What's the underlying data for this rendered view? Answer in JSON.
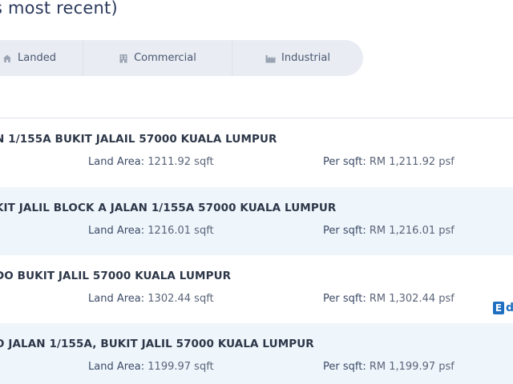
{
  "heading": "s most recent)",
  "tabs": [
    {
      "label": "Landed",
      "icon": "house-icon"
    },
    {
      "label": "Commercial",
      "icon": "building-icon"
    },
    {
      "label": "Industrial",
      "icon": "factory-icon"
    }
  ],
  "labels": {
    "land_area": "Land Area:",
    "per_sqft": "Per sqft:"
  },
  "transactions": [
    {
      "address": "N 1/155A BUKIT JALAIL 57000 KUALA LUMPUR",
      "land_area": "1211.92 sqft",
      "per_sqft": "RM 1,211.92 psf"
    },
    {
      "address": "KIT JALIL BLOCK A JALAN 1/155A 57000 KUALA LUMPUR",
      "land_area": "1216.01 sqft",
      "per_sqft": "RM 1,216.01 psf"
    },
    {
      "address": "DO BUKIT JALIL 57000 KUALA LUMPUR",
      "land_area": "1302.44 sqft",
      "per_sqft": "RM 1,302.44 psf"
    },
    {
      "address": "O JALAN 1/155A, BUKIT JALIL 57000 KUALA LUMPUR",
      "land_area": "1199.97 sqft",
      "per_sqft": "RM 1,199.97 psf"
    }
  ],
  "badge": {
    "letter": "E",
    "text": "dg"
  },
  "colors": {
    "tab_bg": "#e9edf3",
    "row_alt": "#eef5fb",
    "brand": "#1f6fc1"
  }
}
